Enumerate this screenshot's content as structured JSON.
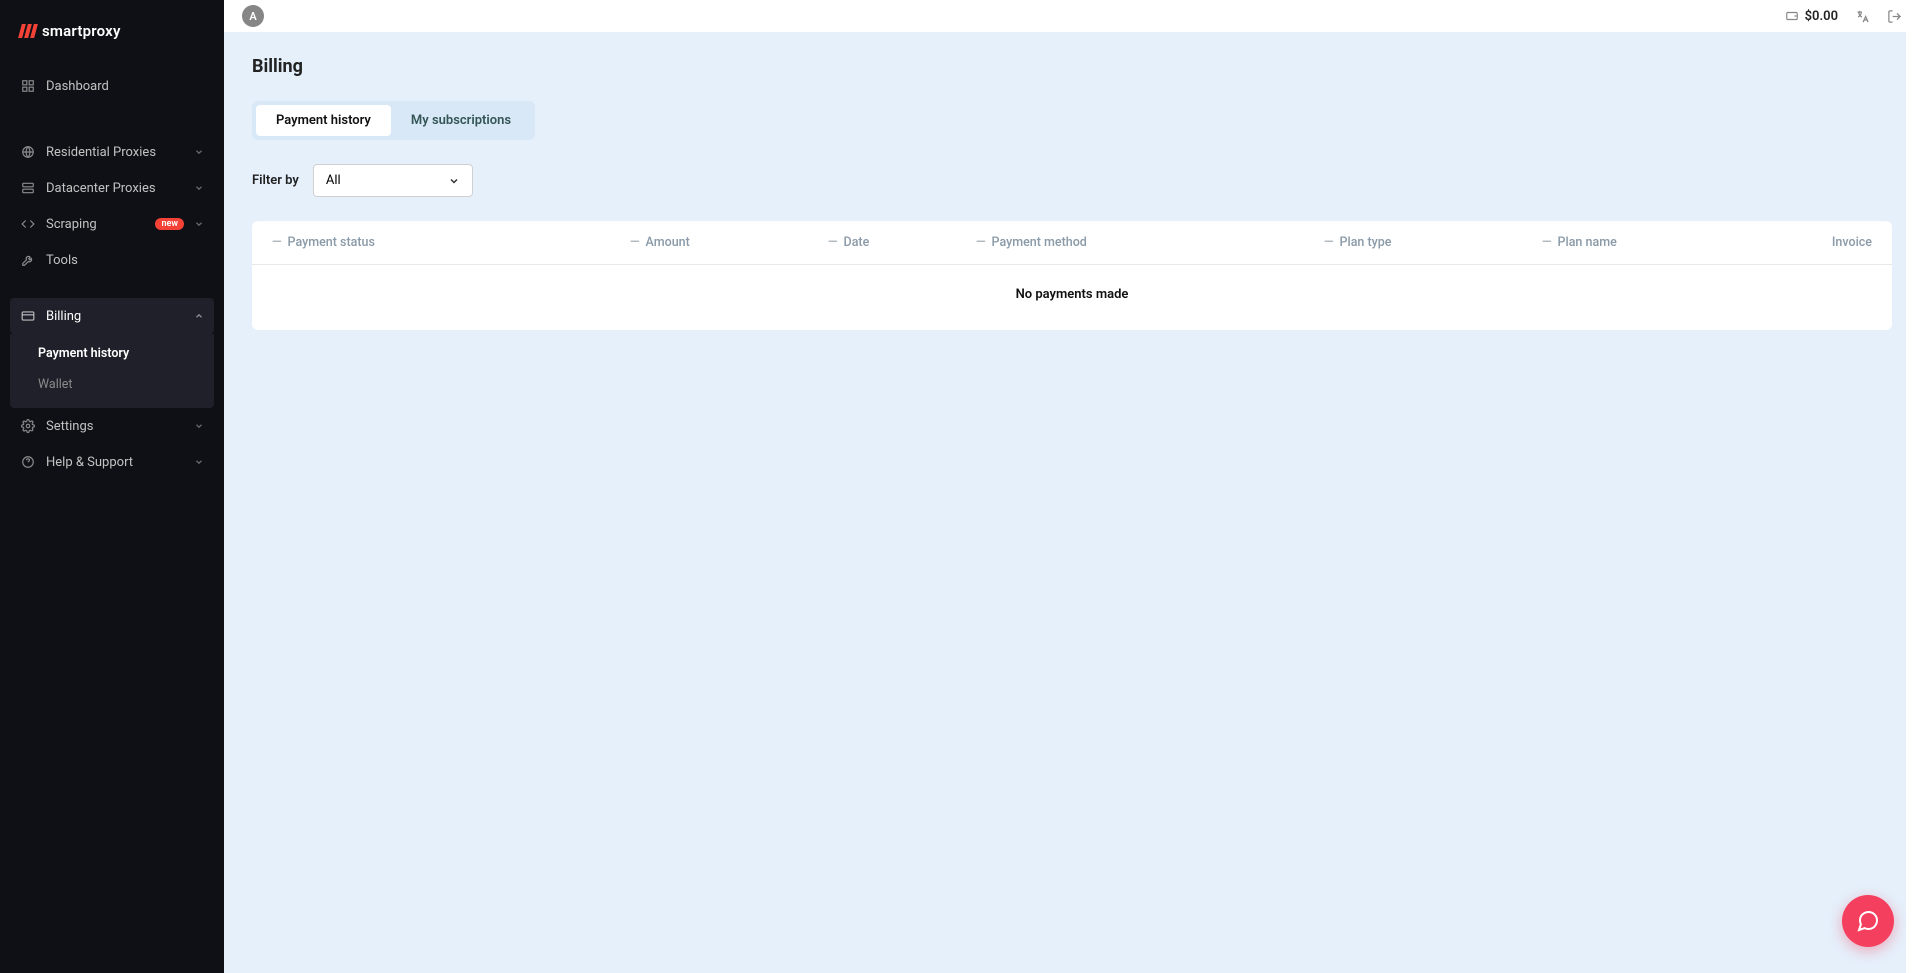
{
  "logo": {
    "text": "smartproxy"
  },
  "sidebar": {
    "dashboard": "Dashboard",
    "residential": "Residential Proxies",
    "datacenter": "Datacenter Proxies",
    "scraping": "Scraping",
    "scraping_badge": "new",
    "tools": "Tools",
    "billing": "Billing",
    "billing_sub": {
      "payment_history": "Payment history",
      "wallet": "Wallet"
    },
    "settings": "Settings",
    "help": "Help & Support"
  },
  "topbar": {
    "avatar_initial": "A",
    "balance": "$0.00"
  },
  "page": {
    "title": "Billing",
    "tabs": {
      "payment_history": "Payment history",
      "my_subscriptions": "My subscriptions"
    },
    "filter": {
      "label": "Filter by",
      "selected": "All"
    },
    "table": {
      "headers": {
        "status": "Payment status",
        "amount": "Amount",
        "date": "Date",
        "method": "Payment method",
        "plan_type": "Plan type",
        "plan_name": "Plan name",
        "invoice": "Invoice"
      },
      "empty": "No payments made"
    }
  }
}
